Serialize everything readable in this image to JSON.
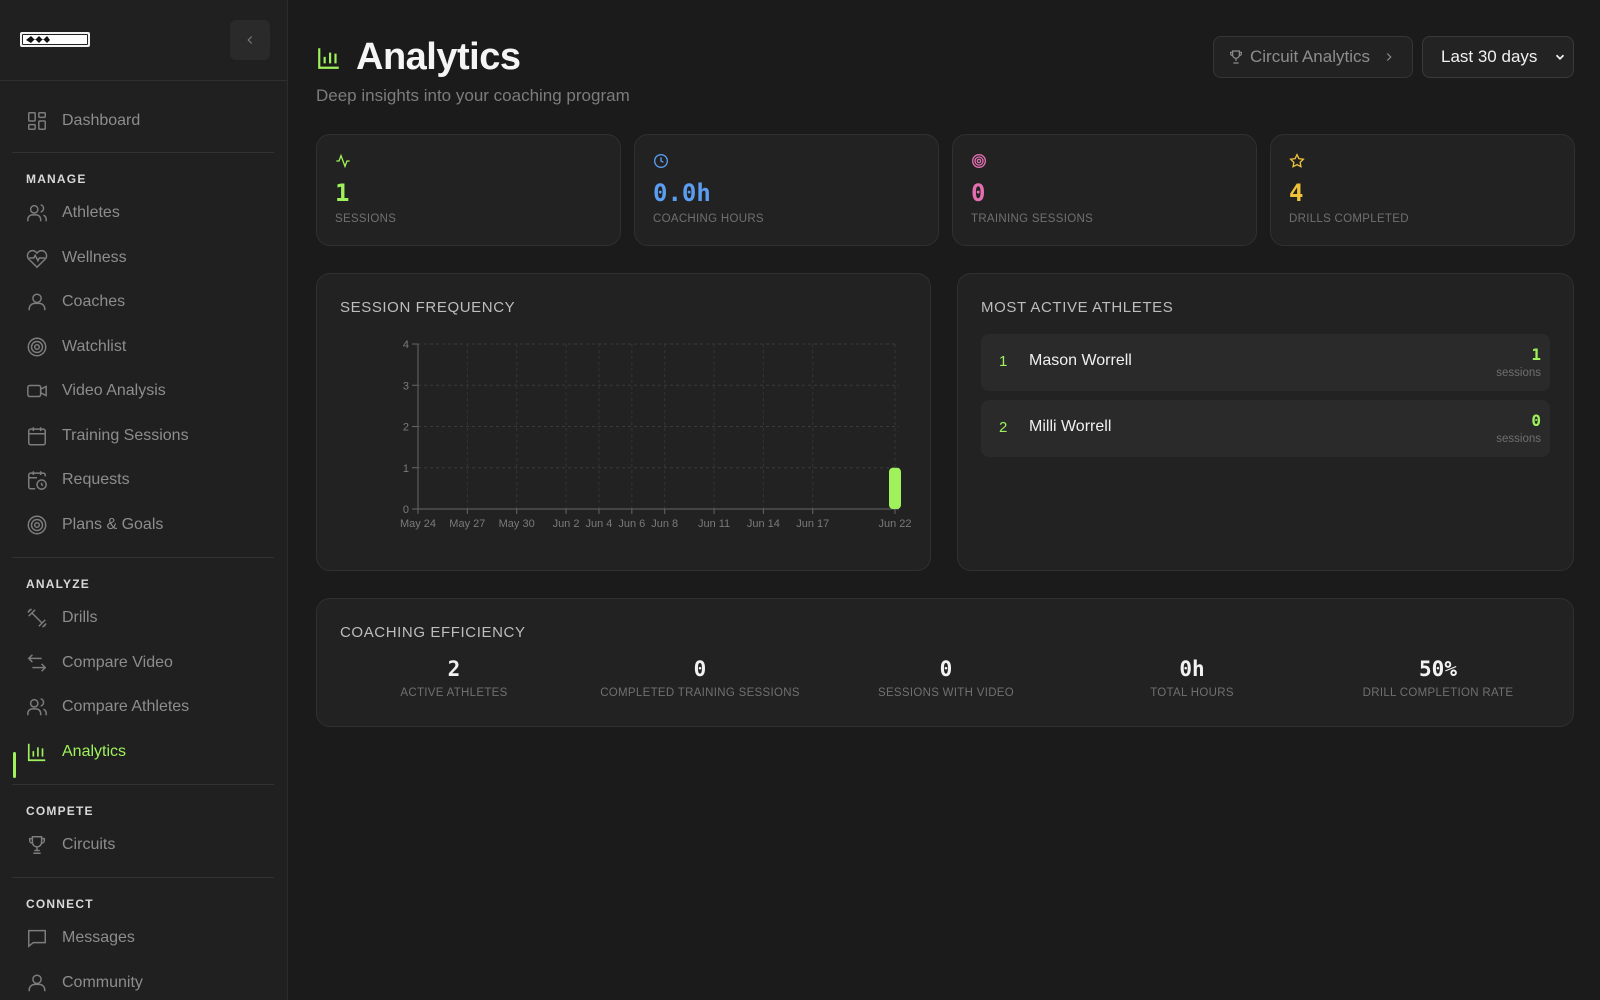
{
  "sidebar": {
    "dashboard": "Dashboard",
    "sections": {
      "manage": "MANAGE",
      "analyze": "ANALYZE",
      "compete": "COMPETE",
      "connect": "CONNECT"
    },
    "manage_items": [
      "Athletes",
      "Wellness",
      "Coaches",
      "Watchlist",
      "Video Analysis",
      "Training Sessions",
      "Requests",
      "Plans & Goals"
    ],
    "analyze_items": [
      "Drills",
      "Compare Video",
      "Compare Athletes",
      "Analytics"
    ],
    "compete_items": [
      "Circuits"
    ],
    "connect_items": [
      "Messages",
      "Community"
    ],
    "active_item": "Analytics"
  },
  "header": {
    "title": "Analytics",
    "subtitle": "Deep insights into your coaching program",
    "circuit_button": "Circuit Analytics",
    "range_select": "Last 30 days"
  },
  "stats": [
    {
      "value": "1",
      "label": "SESSIONS",
      "color": "#9ff25b",
      "icon": "activity-icon"
    },
    {
      "value": "0.0h",
      "label": "COACHING HOURS",
      "color": "#5b9df0",
      "icon": "clock-icon"
    },
    {
      "value": "0",
      "label": "TRAINING SESSIONS",
      "color": "#e36fb0",
      "icon": "target-icon"
    },
    {
      "value": "4",
      "label": "DRILLS COMPLETED",
      "color": "#f0c23a",
      "icon": "star-icon"
    }
  ],
  "session_frequency": {
    "title": "SESSION FREQUENCY"
  },
  "chart_data": {
    "type": "bar",
    "title": "",
    "xlabel": "",
    "ylabel": "",
    "ylim": [
      0,
      4
    ],
    "yticks": [
      "0",
      "1",
      "2",
      "3",
      "4"
    ],
    "xticks": [
      "May 24",
      "May 27",
      "May 30",
      "Jun 2",
      "Jun 4",
      "Jun 6",
      "Jun 8",
      "Jun 11",
      "Jun 14",
      "Jun 17",
      "Jun 22"
    ],
    "x_start": "May 24",
    "x_end": "Jun 22",
    "bars": [
      {
        "x": "Jun 22",
        "value": 1
      }
    ],
    "bar_color": "#9ff25b",
    "grid": true
  },
  "most_active": {
    "title": "MOST ACTIVE ATHLETES",
    "athletes": [
      {
        "rank": "1",
        "name": "Mason Worrell",
        "count": "1",
        "unit": "sessions"
      },
      {
        "rank": "2",
        "name": "Milli Worrell",
        "count": "0",
        "unit": "sessions"
      }
    ]
  },
  "efficiency": {
    "title": "COACHING EFFICIENCY",
    "metrics": [
      {
        "value": "2",
        "label": "ACTIVE ATHLETES"
      },
      {
        "value": "0",
        "label": "COMPLETED TRAINING SESSIONS"
      },
      {
        "value": "0",
        "label": "SESSIONS WITH VIDEO"
      },
      {
        "value": "0h",
        "label": "TOTAL HOURS"
      },
      {
        "value": "50%",
        "label": "DRILL COMPLETION RATE"
      }
    ]
  },
  "colors": {
    "accent": "#9ff25b",
    "background": "#1b1b1b",
    "card": "#222222"
  }
}
